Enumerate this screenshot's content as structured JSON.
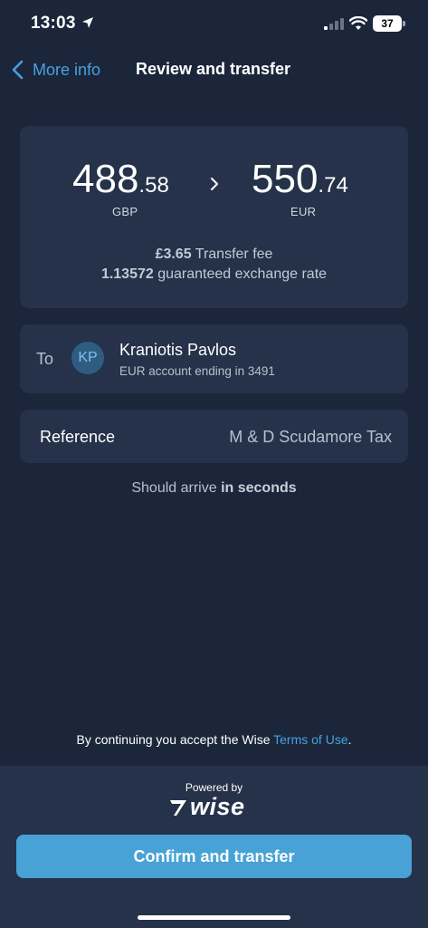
{
  "status_bar": {
    "time": "13:03",
    "battery": "37",
    "icons": [
      "location-arrow-icon",
      "signal-icon",
      "wifi-icon",
      "battery-icon"
    ]
  },
  "nav": {
    "back_label": "More info",
    "title": "Review and transfer"
  },
  "amounts": {
    "send_whole": "488",
    "send_decimal": ".58",
    "send_currency": "GBP",
    "receive_whole": "550",
    "receive_decimal": ".74",
    "receive_currency": "EUR",
    "fee_value": "£3.65",
    "fee_label": " Transfer fee",
    "rate_value": "1.13572",
    "rate_label": " guaranteed exchange rate"
  },
  "recipient": {
    "to_label": "To",
    "initials": "KP",
    "name": "Kraniotis Pavlos",
    "account": "EUR account ending in 3491"
  },
  "reference": {
    "label": "Reference",
    "value": "M & D Scudamore Tax"
  },
  "arrival": {
    "prefix": "Should arrive ",
    "emphasis": "in seconds"
  },
  "terms": {
    "prefix": "By continuing you accept the Wise ",
    "link": "Terms of Use",
    "suffix": "."
  },
  "footer": {
    "powered_by": "Powered by",
    "logo_text": "wise",
    "confirm_label": "Confirm and transfer"
  },
  "colors": {
    "background": "#1b263b",
    "card": "#25324a",
    "accent": "#48a2d6",
    "link": "#4aa0e0"
  }
}
